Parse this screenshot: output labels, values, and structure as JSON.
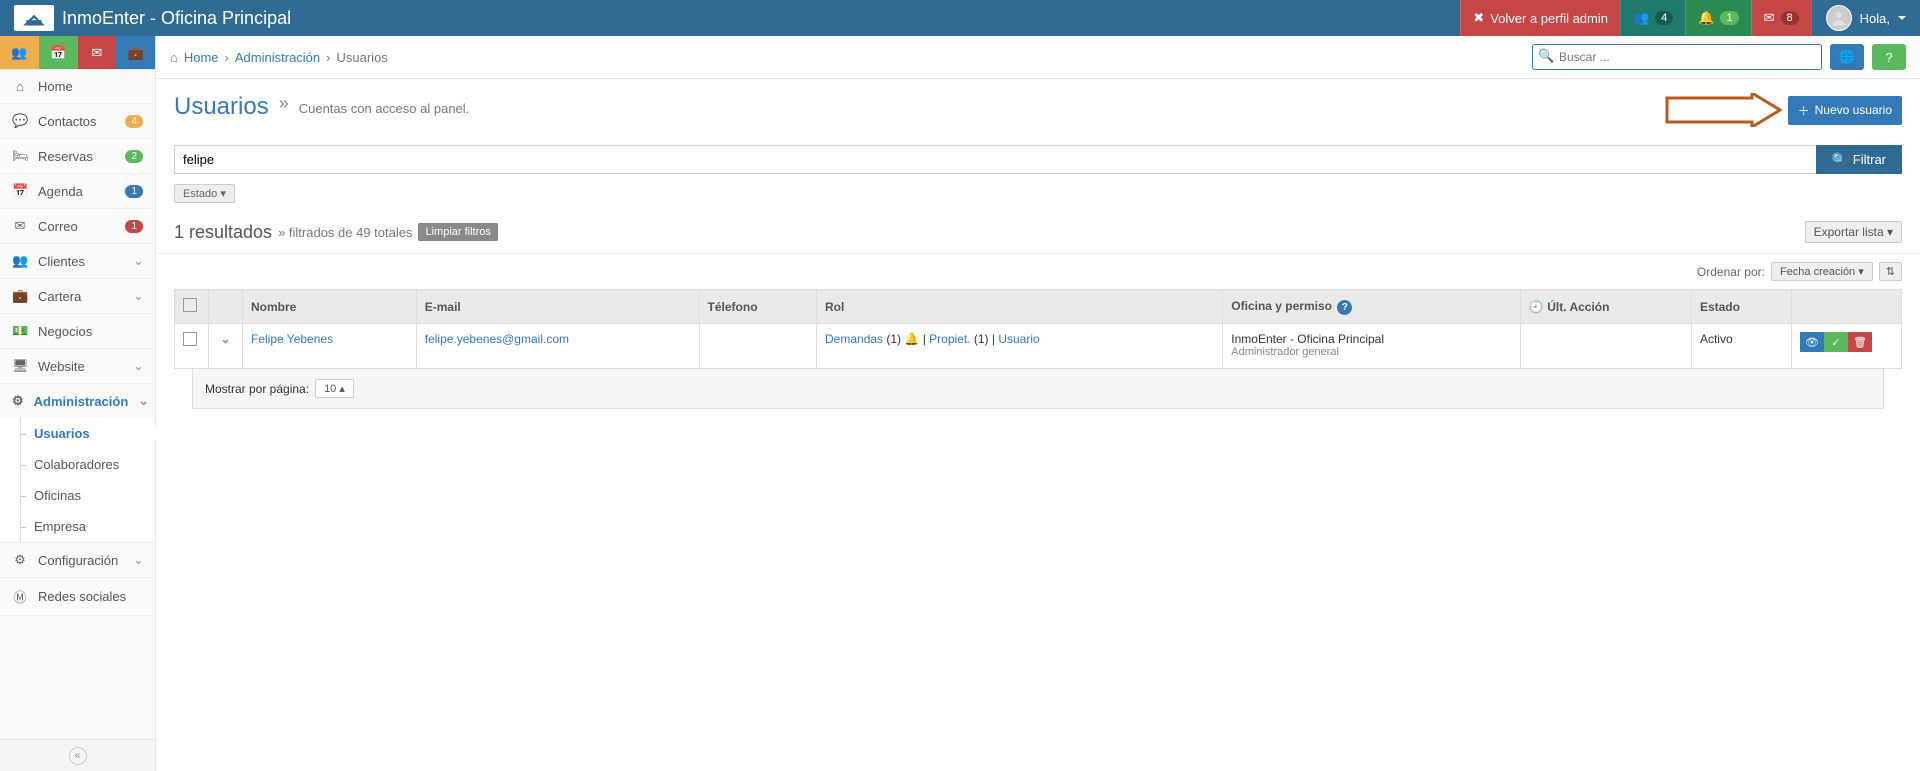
{
  "brand": "InmoEnter - Oficina Principal",
  "topbar": {
    "back_admin": "Volver a perfil admin",
    "people_badge": "4",
    "bell_badge": "1",
    "mail_badge": "8",
    "greeting": "Hola,"
  },
  "sidetools": [
    "people",
    "calendar",
    "mail",
    "briefcase"
  ],
  "nav": [
    {
      "icon": "home",
      "label": "Home"
    },
    {
      "icon": "chat",
      "label": "Contactos",
      "badge": "4",
      "badge_cls": "yellow"
    },
    {
      "icon": "bed",
      "label": "Reservas",
      "badge": "2",
      "badge_cls": "green"
    },
    {
      "icon": "cal",
      "label": "Agenda",
      "badge": "1",
      "badge_cls": "blue"
    },
    {
      "icon": "env",
      "label": "Correo",
      "badge": "1",
      "badge_cls": "red"
    },
    {
      "icon": "grp",
      "label": "Clientes",
      "chev": "down"
    },
    {
      "icon": "case",
      "label": "Cartera",
      "chev": "down"
    },
    {
      "icon": "mon",
      "label": "Negocios"
    },
    {
      "icon": "scr",
      "label": "Website",
      "chev": "down"
    },
    {
      "icon": "adm",
      "label": "Administración",
      "chev": "down",
      "active": true,
      "sub": [
        {
          "label": "Usuarios",
          "active": true
        },
        {
          "label": "Colaboradores"
        },
        {
          "label": "Oficinas"
        },
        {
          "label": "Empresa"
        }
      ]
    },
    {
      "icon": "cog",
      "label": "Configuración",
      "chev": "down"
    },
    {
      "icon": "soc",
      "label": "Redes sociales"
    }
  ],
  "breadcrumb": {
    "home": "Home",
    "admin": "Administración",
    "users": "Usuarios"
  },
  "search": {
    "placeholder": "Buscar ..."
  },
  "page": {
    "title": "Usuarios",
    "desc": "Cuentas con acceso al panel.",
    "new_user": "Nuevo usuario"
  },
  "filter": {
    "value": "felipe",
    "btn": "Filtrar",
    "state_chip": "Estado",
    "estado_caret": "▾"
  },
  "results": {
    "count": "1 resultados",
    "sub": "» filtrados de 49 totales",
    "clear": "Limpiar filtros",
    "export": "Exportar lista",
    "export_caret": "▾"
  },
  "sort": {
    "label": "Ordenar por:",
    "dd": "Fecha creación",
    "caret": "▾"
  },
  "table": {
    "headers": {
      "name": "Nombre",
      "email": "E-mail",
      "phone": "Télefono",
      "rol": "Rol",
      "office": "Oficina y permiso",
      "last": "Últ. Acción",
      "state": "Estado"
    },
    "last_icon_title": "clock",
    "rows": [
      {
        "name": "Felipe Yebenes",
        "email": "felipe.yebenes@gmail.com",
        "phone": "",
        "rol": {
          "demandas": "Demandas",
          "dcount": "(1)",
          "sep1": " | ",
          "propiet": "Propiet.",
          "pcount": "(1)",
          "sep2": " | ",
          "usuario": "Usuario"
        },
        "office": "InmoEnter - Oficina Principal",
        "office_sub": "Administrador general",
        "last": "",
        "state": "Activo"
      }
    ]
  },
  "pager": {
    "label": "Mostrar por página:",
    "size": "10",
    "caret": "▴"
  }
}
